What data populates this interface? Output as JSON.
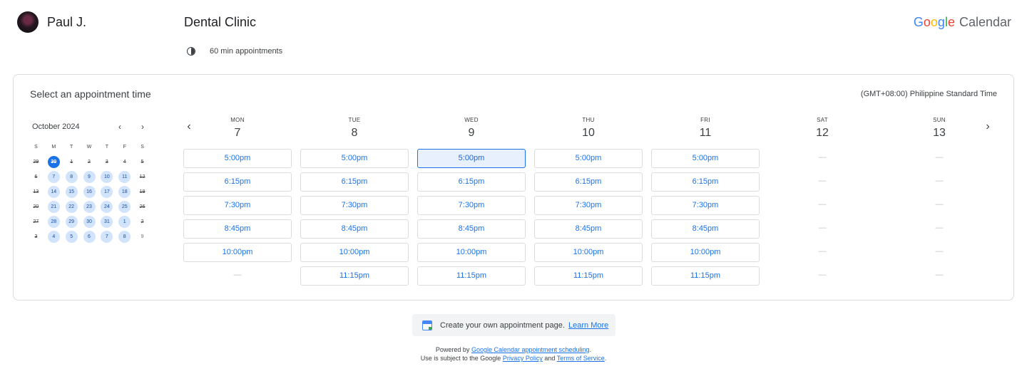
{
  "host": {
    "name": "Paul J."
  },
  "page": {
    "title": "Dental Clinic",
    "duration": "60 min appointments"
  },
  "brand": {
    "letters": [
      "G",
      "o",
      "o",
      "g",
      "l",
      "e"
    ],
    "product": "Calendar"
  },
  "booking": {
    "heading": "Select an appointment time",
    "timezone": "(GMT+08:00) Philippine Standard Time"
  },
  "mini_calendar": {
    "month_label": "October 2024",
    "prev_icon": "chevron-left-icon",
    "next_icon": "chevron-right-icon",
    "weekday_headers": [
      "S",
      "M",
      "T",
      "W",
      "T",
      "F",
      "S"
    ],
    "weeks": [
      [
        {
          "d": "29",
          "s": "na"
        },
        {
          "d": "30",
          "s": "sel"
        },
        {
          "d": "1",
          "s": "na"
        },
        {
          "d": "2",
          "s": "na"
        },
        {
          "d": "3",
          "s": "na"
        },
        {
          "d": "4",
          "s": "na"
        },
        {
          "d": "5",
          "s": "na"
        }
      ],
      [
        {
          "d": "6",
          "s": "na"
        },
        {
          "d": "7",
          "s": "av"
        },
        {
          "d": "8",
          "s": "av"
        },
        {
          "d": "9",
          "s": "av"
        },
        {
          "d": "10",
          "s": "av"
        },
        {
          "d": "11",
          "s": "av"
        },
        {
          "d": "12",
          "s": "na"
        }
      ],
      [
        {
          "d": "13",
          "s": "na"
        },
        {
          "d": "14",
          "s": "av"
        },
        {
          "d": "15",
          "s": "av"
        },
        {
          "d": "16",
          "s": "av"
        },
        {
          "d": "17",
          "s": "av"
        },
        {
          "d": "18",
          "s": "av"
        },
        {
          "d": "19",
          "s": "na"
        }
      ],
      [
        {
          "d": "20",
          "s": "na"
        },
        {
          "d": "21",
          "s": "av"
        },
        {
          "d": "22",
          "s": "av"
        },
        {
          "d": "23",
          "s": "av"
        },
        {
          "d": "24",
          "s": "av"
        },
        {
          "d": "25",
          "s": "av"
        },
        {
          "d": "26",
          "s": "na"
        }
      ],
      [
        {
          "d": "27",
          "s": "na"
        },
        {
          "d": "28",
          "s": "av"
        },
        {
          "d": "29",
          "s": "av"
        },
        {
          "d": "30",
          "s": "av"
        },
        {
          "d": "31",
          "s": "av"
        },
        {
          "d": "1",
          "s": "av"
        },
        {
          "d": "2",
          "s": "na"
        }
      ],
      [
        {
          "d": "3",
          "s": "na"
        },
        {
          "d": "4",
          "s": "av"
        },
        {
          "d": "5",
          "s": "av"
        },
        {
          "d": "6",
          "s": "av"
        },
        {
          "d": "7",
          "s": "av"
        },
        {
          "d": "8",
          "s": "av"
        },
        {
          "d": "9",
          "s": "empty"
        }
      ]
    ]
  },
  "week": {
    "prev_icon": "chevron-left-icon",
    "next_icon": "chevron-right-icon",
    "empty_marker": "—",
    "days": [
      {
        "dow": "MON",
        "num": "7",
        "slots": [
          "5:00pm",
          "6:15pm",
          "7:30pm",
          "8:45pm",
          "10:00pm",
          null
        ]
      },
      {
        "dow": "TUE",
        "num": "8",
        "slots": [
          "5:00pm",
          "6:15pm",
          "7:30pm",
          "8:45pm",
          "10:00pm",
          "11:15pm"
        ]
      },
      {
        "dow": "WED",
        "num": "9",
        "slots": [
          "5:00pm",
          "6:15pm",
          "7:30pm",
          "8:45pm",
          "10:00pm",
          "11:15pm"
        ],
        "highlighted": 0
      },
      {
        "dow": "THU",
        "num": "10",
        "slots": [
          "5:00pm",
          "6:15pm",
          "7:30pm",
          "8:45pm",
          "10:00pm",
          "11:15pm"
        ]
      },
      {
        "dow": "FRI",
        "num": "11",
        "slots": [
          "5:00pm",
          "6:15pm",
          "7:30pm",
          "8:45pm",
          "10:00pm",
          "11:15pm"
        ]
      },
      {
        "dow": "SAT",
        "num": "12",
        "slots": [
          null,
          null,
          null,
          null,
          null,
          null
        ]
      },
      {
        "dow": "SUN",
        "num": "13",
        "slots": [
          null,
          null,
          null,
          null,
          null,
          null
        ]
      }
    ]
  },
  "footer": {
    "promo_icon": "google-calendar-icon",
    "promo_text": "Create your own appointment page.",
    "promo_link": "Learn More",
    "powered_prefix": "Powered by ",
    "powered_link": "Google Calendar appointment scheduling",
    "powered_suffix": ".",
    "terms_prefix": "Use is subject to the Google ",
    "privacy_link": "Privacy Policy",
    "terms_and": " and ",
    "terms_link": "Terms of Service",
    "terms_suffix": "."
  }
}
